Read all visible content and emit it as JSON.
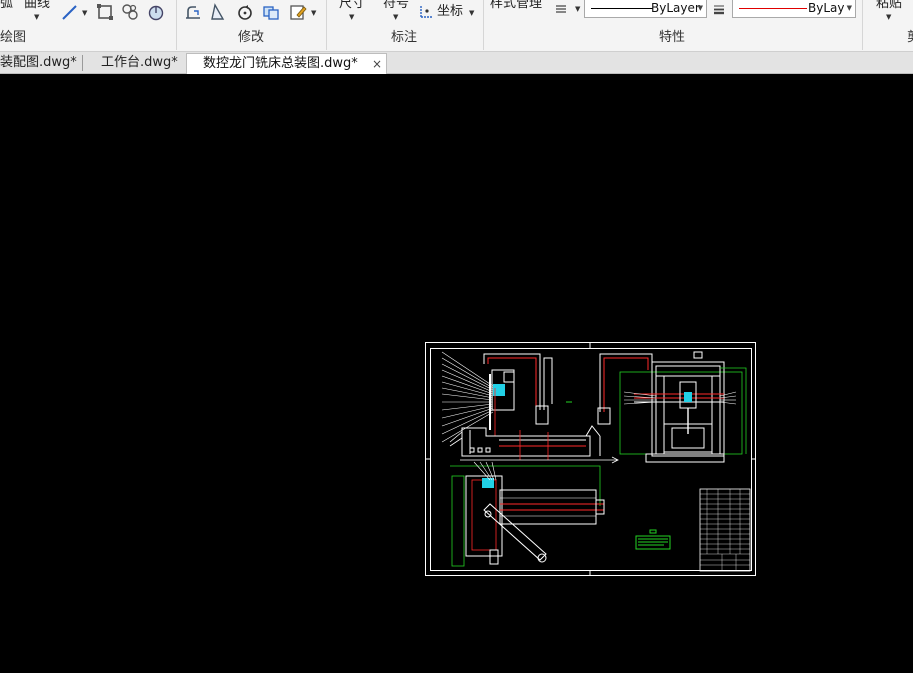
{
  "ribbon": {
    "draw": {
      "arc_partial": "弧",
      "curve_label": "曲线",
      "group_title": "绘图"
    },
    "modify": {
      "group_title": "修改"
    },
    "annotate": {
      "dimension_label": "尺寸",
      "symbol_label": "符号",
      "coordinate_label": "坐标",
      "group_title": "标注"
    },
    "properties": {
      "style_manager_label": "样式管理",
      "linetype_value": "ByLayer",
      "color_value": "ByLayer",
      "color_value_clipped": "ByLaye",
      "group_title": "特性",
      "linetype_swatch_color": "#000000",
      "color_swatch_color": "#e00000"
    },
    "clipboard": {
      "paste_label": "粘贴",
      "group_title_partial": "剪"
    }
  },
  "tabs": [
    {
      "label": "装配图.dwg*",
      "active": false
    },
    {
      "label": "工作台.dwg*",
      "active": false
    },
    {
      "label": "数控龙门铣床总装图.dwg*",
      "active": true,
      "close": "×"
    }
  ],
  "canvas": {
    "background": "#000000",
    "drawing_colors": {
      "frame": "#ffffff",
      "red": "#ff2a2a",
      "green": "#23d323",
      "cyan": "#22d0e6",
      "white": "#ffffff"
    }
  }
}
